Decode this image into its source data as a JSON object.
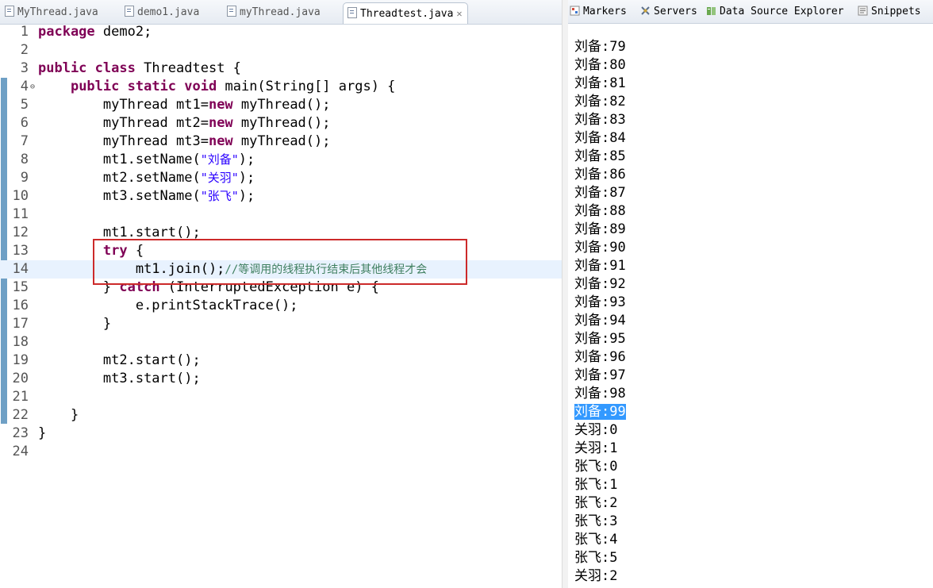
{
  "editor": {
    "tabs": [
      {
        "label": "MyThread.java",
        "active": false
      },
      {
        "label": "demo1.java",
        "active": false
      },
      {
        "label": "myThread.java",
        "active": false
      },
      {
        "label": "Threadtest.java",
        "active": true
      }
    ],
    "line_numbers": [
      "1",
      "2",
      "3",
      "4",
      "5",
      "6",
      "7",
      "8",
      "9",
      "10",
      "11",
      "12",
      "13",
      "14",
      "15",
      "16",
      "17",
      "18",
      "19",
      "20",
      "21",
      "22",
      "23",
      "24"
    ],
    "code": {
      "l1": {
        "kw": "package",
        "rest": " demo2;"
      },
      "l3": {
        "kw1": "public",
        "kw2": "class",
        "rest": " Threadtest {"
      },
      "l4": {
        "kw1": "public",
        "kw2": "static",
        "kw3": "void",
        "rest": " main(String[] args) {"
      },
      "l5": {
        "a": "myThread mt1=",
        "kw": "new",
        "b": " myThread();"
      },
      "l6": {
        "a": "myThread mt2=",
        "kw": "new",
        "b": " myThread();"
      },
      "l7": {
        "a": "myThread mt3=",
        "kw": "new",
        "b": " myThread();"
      },
      "l8": {
        "a": "mt1.setName(",
        "str": "\"刘备\"",
        "b": ");"
      },
      "l9": {
        "a": "mt2.setName(",
        "str": "\"关羽\"",
        "b": ");"
      },
      "l10": {
        "a": "mt3.setName(",
        "str": "\"张飞\"",
        "b": ");"
      },
      "l12": "mt1.start();",
      "l13": {
        "kw": "try",
        "rest": " {"
      },
      "l14": {
        "a": "mt1.join();",
        "comment": "//等调用的线程执行结束后其他线程才会"
      },
      "l15": {
        "a": "} ",
        "kw": "catch",
        "b": " (InterruptedException e) {"
      },
      "l16": "e.printStackTrace();",
      "l17": "}",
      "l19": "mt2.start();",
      "l20": "mt3.start();",
      "l22": "}",
      "l23": "}"
    }
  },
  "console": {
    "tabs": [
      {
        "label": "Markers",
        "icon": "markers-icon"
      },
      {
        "label": "Servers",
        "icon": "servers-icon"
      },
      {
        "label": "Data Source Explorer",
        "icon": "data-source-icon"
      },
      {
        "label": "Snippets",
        "icon": "snippets-icon"
      }
    ],
    "lines": [
      "刘备:79",
      "刘备:80",
      "刘备:81",
      "刘备:82",
      "刘备:83",
      "刘备:84",
      "刘备:85",
      "刘备:86",
      "刘备:87",
      "刘备:88",
      "刘备:89",
      "刘备:90",
      "刘备:91",
      "刘备:92",
      "刘备:93",
      "刘备:94",
      "刘备:95",
      "刘备:96",
      "刘备:97",
      "刘备:98",
      "刘备:99",
      "关羽:0",
      "关羽:1",
      "张飞:0",
      "张飞:1",
      "张飞:2",
      "张飞:3",
      "张飞:4",
      "张飞:5",
      "关羽:2"
    ],
    "selected_line": "刘备:99"
  },
  "colors": {
    "keyword": "#7f0055",
    "string": "#2a00ff",
    "comment": "#3f7f5f",
    "highlight_box": "#cc2a2a",
    "selection": "#3399ff"
  }
}
